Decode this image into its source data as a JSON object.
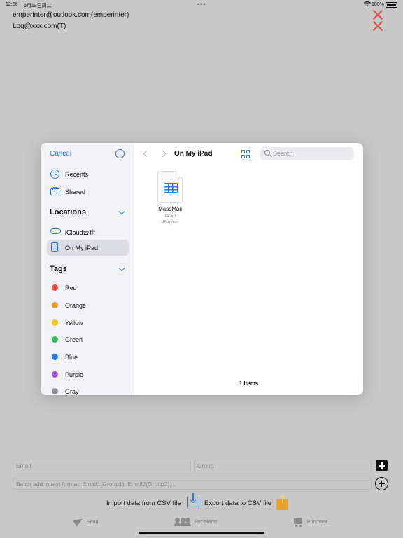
{
  "status_bar": {
    "time": "12:56",
    "date": "6月18日周二",
    "dots": "•••",
    "battery_percent": "100%"
  },
  "accounts": [
    "emperinter@outlook.com(emperinter)",
    "Log@xxx.com(T)"
  ],
  "picker": {
    "cancel_label": "Cancel",
    "sidebar": {
      "recents": "Recents",
      "shared": "Shared",
      "locations_title": "Locations",
      "locations": [
        "iCloud云盘",
        "On My iPad"
      ],
      "selected_location": "On My iPad",
      "tags_title": "Tags",
      "tags": [
        {
          "name": "Red",
          "color": "#e8453c"
        },
        {
          "name": "Orange",
          "color": "#f29a17"
        },
        {
          "name": "Yellow",
          "color": "#f5c617"
        },
        {
          "name": "Green",
          "color": "#34b65a"
        },
        {
          "name": "Blue",
          "color": "#2a7ae2"
        },
        {
          "name": "Purple",
          "color": "#a152d4"
        },
        {
          "name": "Gray",
          "color": "#8e8e93"
        }
      ]
    },
    "main": {
      "title": "On My iPad",
      "search_placeholder": "Search",
      "files": [
        {
          "name": "MassMail",
          "time": "12:56",
          "size": "48 bytes"
        }
      ],
      "items_count": "1 items"
    }
  },
  "form": {
    "email_placeholder": "Email",
    "group_placeholder": "Group",
    "batch_placeholder": "Batch add in text format: Email1(Group1), Email2(Group2),...",
    "import_label": "Import data from CSV file",
    "export_label": "Export data to CSV file"
  },
  "tabs": {
    "send": "Send",
    "recipients": "Recipients",
    "purchase": "Purchase"
  },
  "colors": {
    "accent": "#2a7ae2",
    "close_red": "#d6504a",
    "export_orange": "#e9a12a"
  }
}
